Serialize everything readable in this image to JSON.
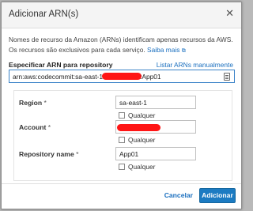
{
  "dialog": {
    "title": "Adicionar ARN(s)",
    "close_icon": "close-icon",
    "description": "Nomes de recurso da Amazon (ARNs) identificam apenas recursos da AWS. Os recursos são exclusivos para cada serviço.",
    "learn_more": "Saiba mais",
    "external_link_icon": "external-link-icon"
  },
  "arn": {
    "label": "Especificar ARN para repository",
    "manual_link": "Listar ARNs manualmente",
    "value_prefix": "arn:aws:codecommit:sa-east-1",
    "value_suffix": ":App01",
    "copy_icon": "copy-icon"
  },
  "fields": {
    "region": {
      "label": "Region",
      "required_mark": "*",
      "value": "sa-east-1",
      "any_label": "Qualquer"
    },
    "account": {
      "label": "Account",
      "required_mark": "*",
      "value": "",
      "any_label": "Qualquer"
    },
    "repository": {
      "label": "Repository name",
      "required_mark": "*",
      "value": "App01",
      "any_label": "Qualquer"
    }
  },
  "footer": {
    "cancel_label": "Cancelar",
    "add_label": "Adicionar"
  },
  "colors": {
    "accent": "#1c7bc2",
    "link": "#1a6fbf",
    "redaction": "#ff1515"
  }
}
